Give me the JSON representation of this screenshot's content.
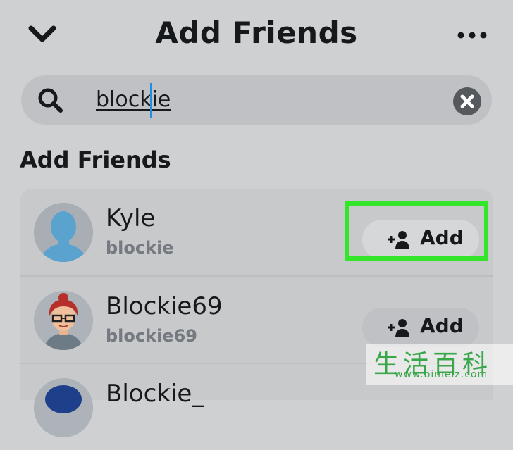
{
  "header": {
    "title": "Add Friends",
    "back_icon": "chevron-down-icon",
    "more_icon": "more-horizontal-icon"
  },
  "search": {
    "value": "blockie",
    "search_icon": "search-icon",
    "clear_icon": "clear-icon"
  },
  "section": {
    "title": "Add Friends"
  },
  "results": [
    {
      "name": "Kyle",
      "username": "blockie",
      "add_label": "Add",
      "avatar": "default-avatar",
      "highlighted": true
    },
    {
      "name": "Blockie69",
      "username": "blockie69",
      "add_label": "Add",
      "avatar": "bitmoji-avatar",
      "highlighted": false
    },
    {
      "name": "Blockie_",
      "username": "",
      "add_label": "",
      "avatar": "bitmoji-avatar",
      "highlighted": false
    }
  ],
  "colors": {
    "highlight": "#33e62a",
    "background": "#cfd0d2"
  },
  "watermark": {
    "cn": "生活百科",
    "url": "www.bimeiz.com"
  }
}
